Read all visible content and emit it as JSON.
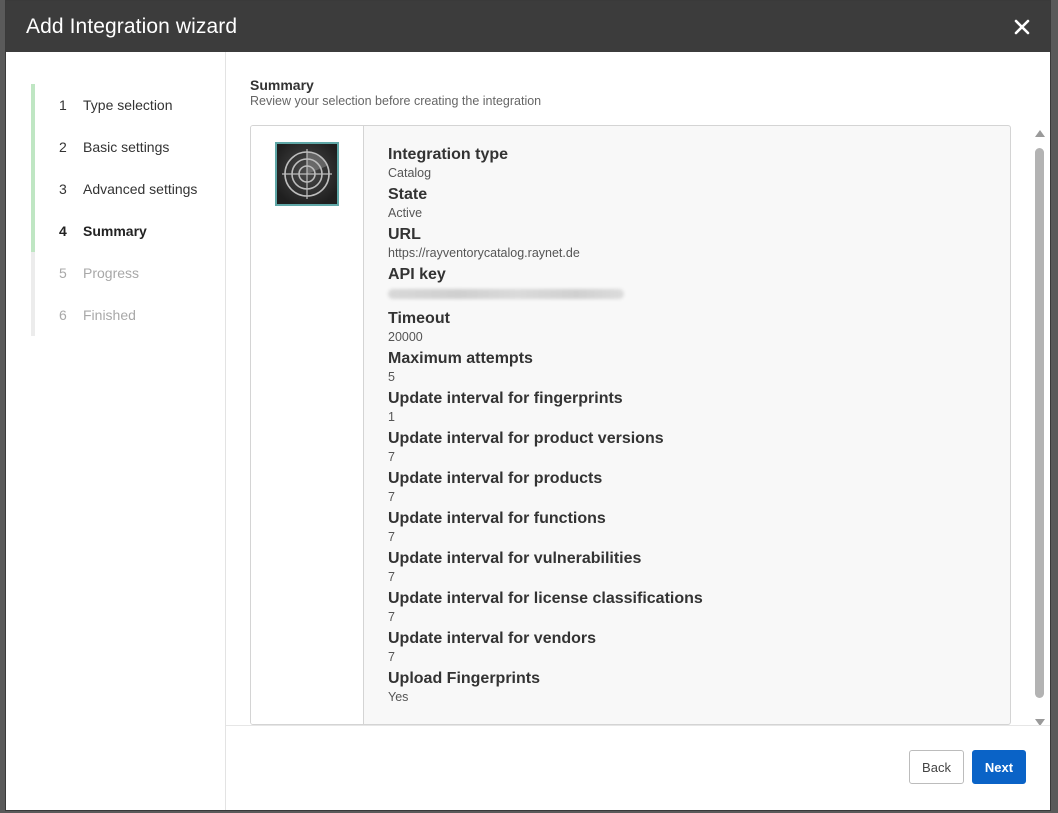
{
  "dialog": {
    "title": "Add Integration wizard"
  },
  "steps": [
    {
      "num": "1",
      "label": "Type selection",
      "state": "done"
    },
    {
      "num": "2",
      "label": "Basic settings",
      "state": "done"
    },
    {
      "num": "3",
      "label": "Advanced settings",
      "state": "done"
    },
    {
      "num": "4",
      "label": "Summary",
      "state": "current"
    },
    {
      "num": "5",
      "label": "Progress",
      "state": "future"
    },
    {
      "num": "6",
      "label": "Finished",
      "state": "future"
    }
  ],
  "summary": {
    "title": "Summary",
    "subtitle": "Review your selection before creating the integration",
    "fields": [
      {
        "label": "Integration type",
        "value": "Catalog"
      },
      {
        "label": "State",
        "value": "Active"
      },
      {
        "label": "URL",
        "value": "https://rayventorycatalog.raynet.de"
      },
      {
        "label": "API key",
        "value": "",
        "blurred": true
      },
      {
        "label": "Timeout",
        "value": "20000"
      },
      {
        "label": "Maximum attempts",
        "value": "5"
      },
      {
        "label": "Update interval for fingerprints",
        "value": "1"
      },
      {
        "label": "Update interval for product versions",
        "value": "7"
      },
      {
        "label": "Update interval for products",
        "value": "7"
      },
      {
        "label": "Update interval for functions",
        "value": "7"
      },
      {
        "label": "Update interval for vulnerabilities",
        "value": "7"
      },
      {
        "label": "Update interval for license classifications",
        "value": "7"
      },
      {
        "label": "Update interval for vendors",
        "value": "7"
      },
      {
        "label": "Upload Fingerprints",
        "value": "Yes"
      }
    ]
  },
  "buttons": {
    "back": "Back",
    "next": "Next"
  },
  "colors": {
    "titlebar": "#3c3c3c",
    "primary": "#0a63c7",
    "step_done": "#bfe6c3"
  },
  "icons": {
    "close": "close-icon",
    "logo": "radar-target-icon"
  }
}
